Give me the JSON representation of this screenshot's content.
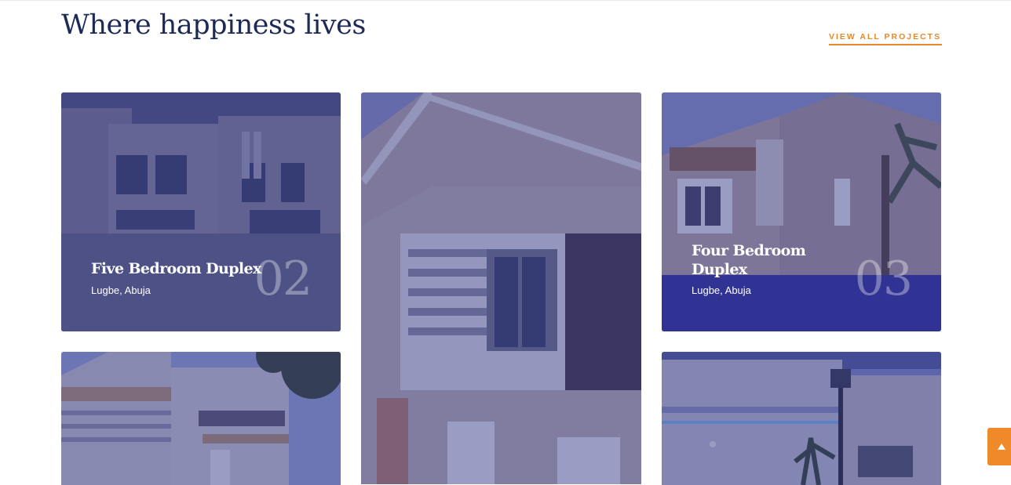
{
  "section": {
    "heading": "Where happiness lives",
    "view_all_label": "VIEW ALL PROJECTS",
    "view_all_arrow": "→"
  },
  "projects": [
    {
      "title": "Five Bedroom Duplex",
      "location": "Lugbe, Abuja",
      "number": "02"
    },
    {
      "title": "Four Bedroom Duplex",
      "location": "Lugbe, Abuja",
      "number": "03"
    }
  ],
  "colors": {
    "heading": "#1d2a55",
    "accent": "#e58a2a",
    "overlay": "#2c3282",
    "band": "#303393"
  },
  "icons": {
    "scroll_top": "chevron-up-icon",
    "arrow": "arrow-right-icon"
  }
}
